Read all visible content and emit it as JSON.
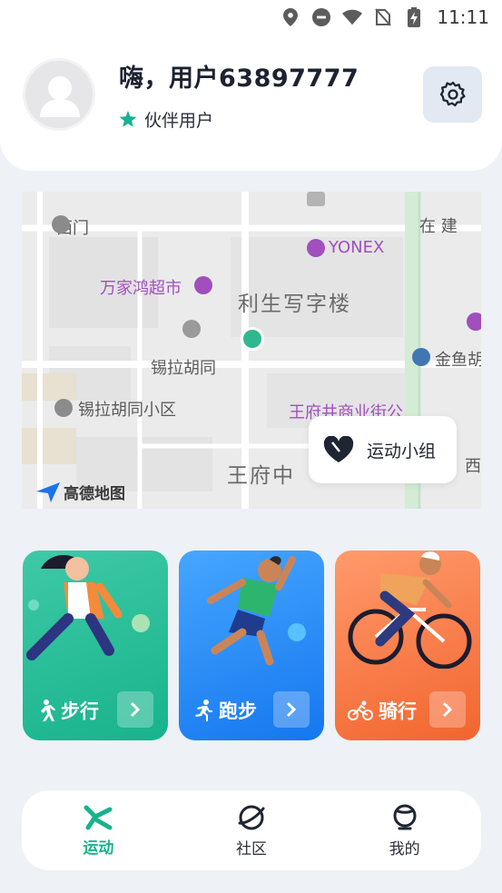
{
  "status_bar": {
    "time": "11:11"
  },
  "profile": {
    "greeting": "嗨，用户63897777",
    "member_level": "伙伴用户"
  },
  "map": {
    "labels": {
      "west_gate": "西门",
      "construction": "在 建",
      "yonex": "YONEX",
      "supermarket": "万家鸿超市",
      "building": "利生写字楼",
      "xila_hutong": "锡拉胡同",
      "jinyu": "金鱼胡",
      "xila_community": "锡拉胡同小区",
      "wangfujing_street": "王府井商业街公",
      "wangfu_middle": "王府中",
      "west_short": "西",
      "amap": "高德地图"
    },
    "groups_button": "运动小组"
  },
  "sports": [
    {
      "label": "步行",
      "accent": "#17b38c"
    },
    {
      "label": "跑步",
      "accent": "#1577ef"
    },
    {
      "label": "骑行",
      "accent": "#f2652e"
    }
  ],
  "tabs": [
    {
      "label": "运动",
      "active": true
    },
    {
      "label": "社区",
      "active": false
    },
    {
      "label": "我的",
      "active": false
    }
  ]
}
